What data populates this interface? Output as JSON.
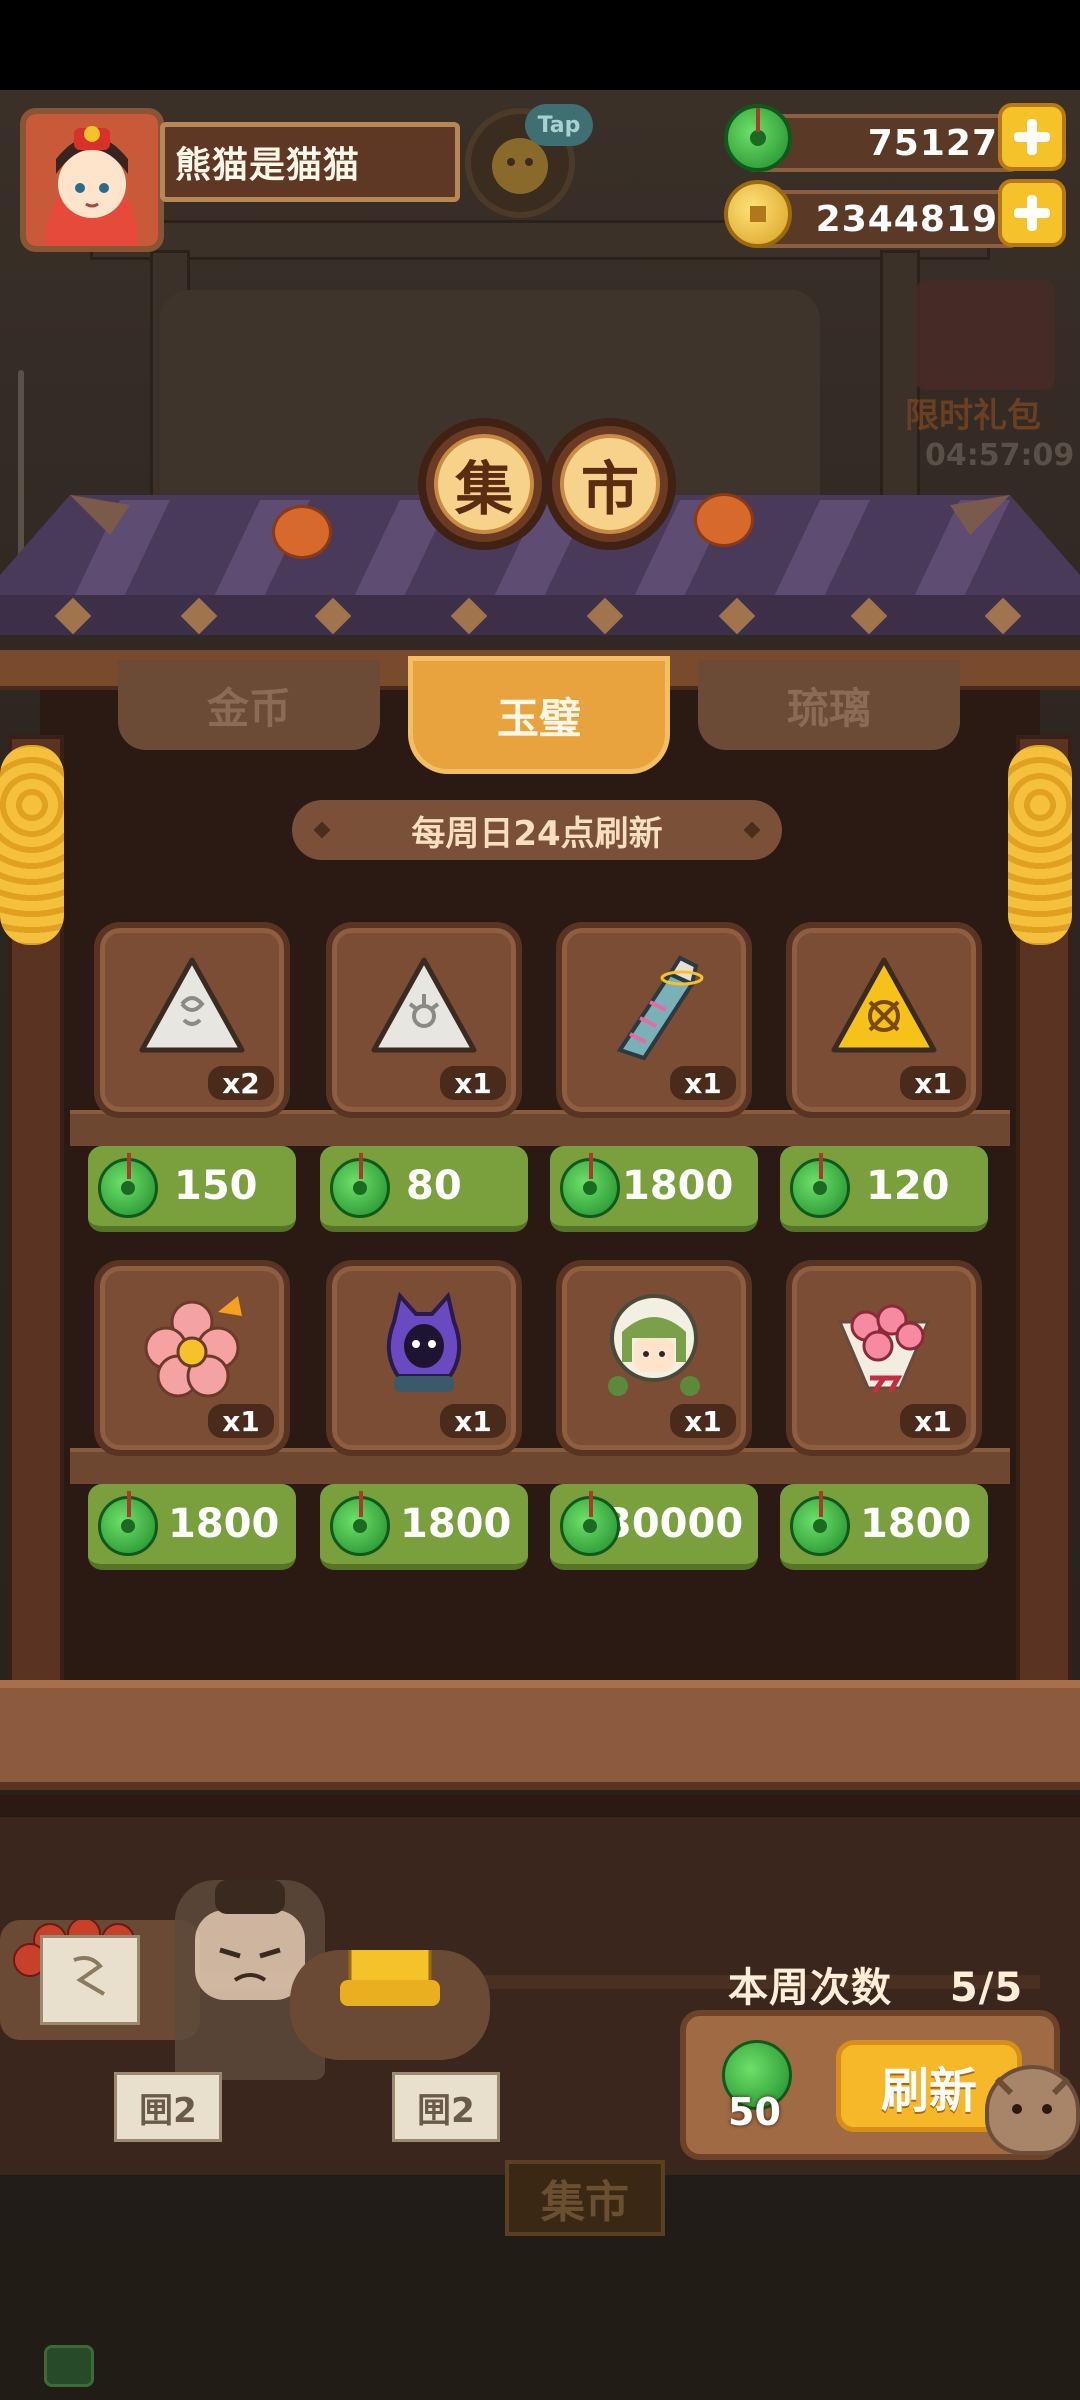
{
  "player": {
    "name": "熊猫是猫猫",
    "tap_badge": "Tap"
  },
  "currencies": {
    "jade": "75127",
    "coins": "2344819"
  },
  "gift": {
    "label": "限时礼包",
    "timer": "04:57:09"
  },
  "title": {
    "char1": "集",
    "char2": "市"
  },
  "tabs": [
    {
      "label": "金币",
      "active": false
    },
    {
      "label": "玉璧",
      "active": true
    },
    {
      "label": "琉璃",
      "active": false
    }
  ],
  "refresh_note": "每周日24点刷新",
  "items": [
    {
      "icon": "white-triangle-stone-icon",
      "qty": "x2",
      "price": "150"
    },
    {
      "icon": "white-triangle-seal-icon",
      "qty": "x1",
      "price": "80"
    },
    {
      "icon": "firework-rocket-icon",
      "qty": "x1",
      "price": "1800"
    },
    {
      "icon": "gold-triangle-seal-icon",
      "qty": "x1",
      "price": "120"
    },
    {
      "icon": "pink-flower-icon",
      "qty": "x1",
      "price": "1800"
    },
    {
      "icon": "purple-creature-icon",
      "qty": "x1",
      "price": "1800"
    },
    {
      "icon": "green-hair-girl-icon",
      "qty": "x1",
      "price": "30000"
    },
    {
      "icon": "rose-bouquet-icon",
      "qty": "x1",
      "price": "1800"
    }
  ],
  "vendor_signs": [
    "㘡2",
    "㘡2"
  ],
  "weekly": {
    "label": "本周次数",
    "count": "5/5"
  },
  "refresh": {
    "cost": "50",
    "button_label": "刷新"
  },
  "bottom_sign": "集市",
  "colors": {
    "price_green": "#7aa03e",
    "tab_active": "#e8a23e",
    "refresh_button": "#f6b829",
    "plus_button": "#f6c22a"
  }
}
